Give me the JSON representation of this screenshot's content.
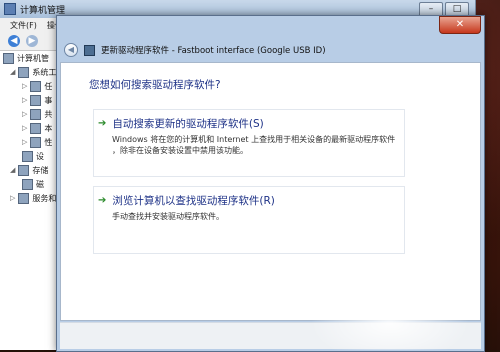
{
  "background_window": {
    "title": "计算机管理",
    "menu": [
      "文件(F)",
      "操作(A)"
    ],
    "tree": [
      {
        "label": "计算机管",
        "level": 0
      },
      {
        "label": "系统工",
        "level": 1
      },
      {
        "label": "任",
        "level": 2
      },
      {
        "label": "事",
        "level": 2
      },
      {
        "label": "共",
        "level": 2
      },
      {
        "label": "本",
        "level": 2
      },
      {
        "label": "性",
        "level": 2
      },
      {
        "label": "设",
        "level": 2
      },
      {
        "label": "存储",
        "level": 1
      },
      {
        "label": "磁",
        "level": 2
      },
      {
        "label": "服务和",
        "level": 1
      }
    ]
  },
  "dialog": {
    "title": "更新驱动程序软件 - Fastboot interface (Google USB ID)",
    "close_label": "✕",
    "question": "您想如何搜索驱动程序软件?",
    "options": [
      {
        "title": "自动搜索更新的驱动程序软件(S)",
        "desc_line1": "Windows 将在您的计算机和 Internet 上查找用于相关设备的最新驱动程序软件",
        "desc_line2": "，除非在设备安装设置中禁用该功能。"
      },
      {
        "title": "浏览计算机以查找驱动程序软件(R)",
        "desc_line1": "手动查找并安装驱动程序软件。"
      }
    ]
  }
}
